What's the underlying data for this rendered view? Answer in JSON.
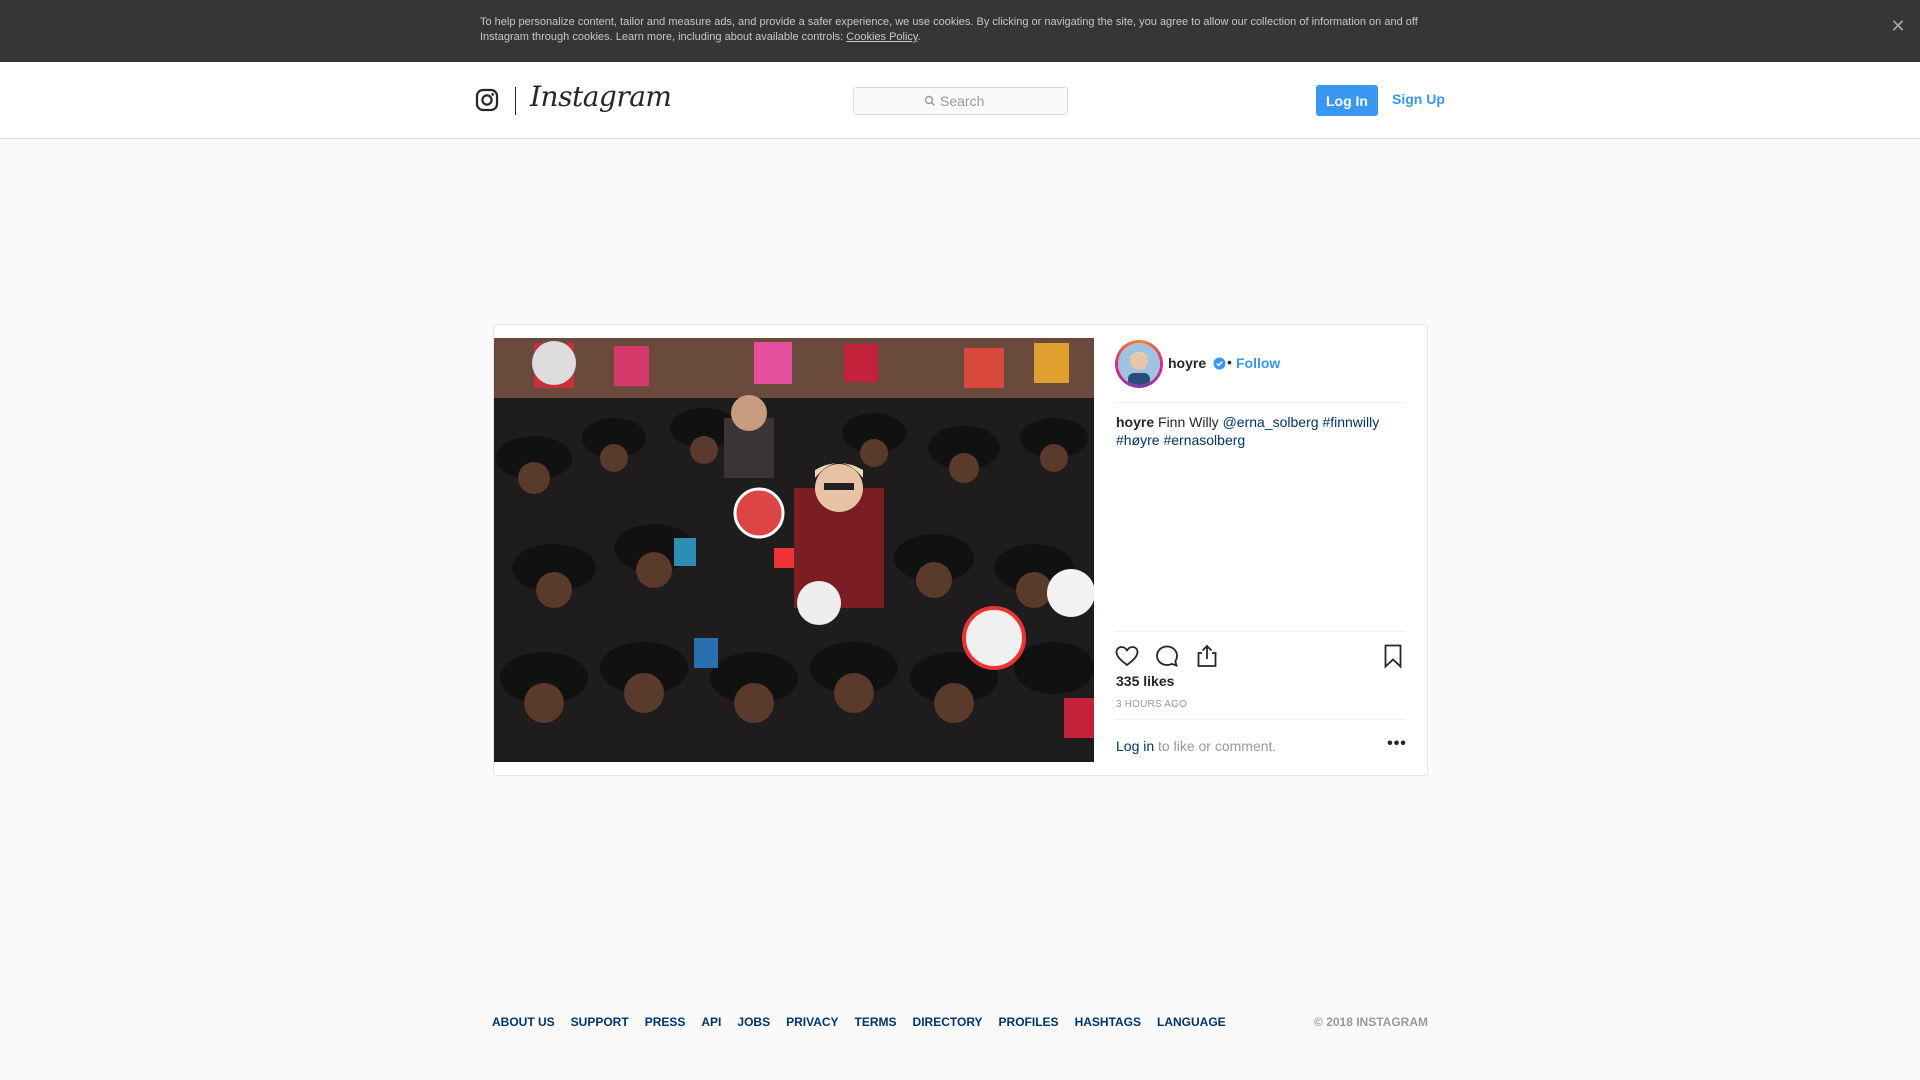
{
  "cookie_banner": {
    "text": "To help personalize content, tailor and measure ads, and provide a safer experience, we use cookies. By clicking or navigating the site, you agree to allow our collection of information on and off Instagram through cookies. Learn more, including about available controls: ",
    "link_label": "Cookies Policy",
    "suffix": ".",
    "close_icon": "close-icon"
  },
  "header": {
    "wordmark": "Instagram",
    "logo_icon": "camera-glyph-icon",
    "search_placeholder": "Search",
    "search_icon": "search-icon",
    "login_label": "Log In",
    "signup_label": "Sign Up"
  },
  "post": {
    "username": "hoyre",
    "separator": "•",
    "follow_label": "Follow",
    "caption": {
      "author": "hoyre",
      "text": "Finn Willy",
      "mention": "@erna_solberg",
      "tags": [
        "#finnwilly",
        "#høyre",
        "#ernasolberg"
      ]
    },
    "likes": "335 likes",
    "time": "3 HOURS AGO",
    "login_link": "Log in",
    "login_suffix": " to like or comment.",
    "more_label": "•••",
    "actions": [
      "heart-icon",
      "comment-icon",
      "share-icon",
      "bookmark-icon"
    ]
  },
  "footer": {
    "links": [
      "ABOUT US",
      "SUPPORT",
      "PRESS",
      "API",
      "JOBS",
      "PRIVACY",
      "TERMS",
      "DIRECTORY",
      "PROFILES",
      "HASHTAGS",
      "LANGUAGE"
    ],
    "copyright": "© 2018 INSTAGRAM"
  },
  "colors": {
    "accent": "#3897f0",
    "link": "#003569",
    "banner": "#363636"
  }
}
